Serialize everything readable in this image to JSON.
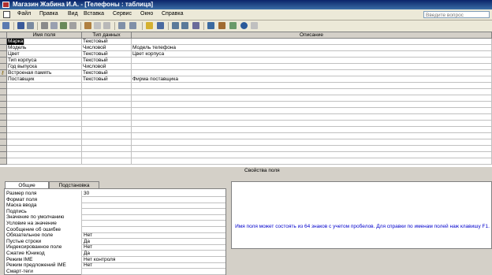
{
  "window": {
    "title": "Магазин Жабина И.А. - [Телефоны : таблица]"
  },
  "menu": {
    "items": [
      "Файл",
      "Правка",
      "Вид",
      "Вставка",
      "Сервис",
      "Окно",
      "Справка"
    ],
    "help_placeholder": "Введите вопрос"
  },
  "table": {
    "headers": {
      "name": "Имя поля",
      "type": "Тип данных",
      "desc": "Описание"
    },
    "rows": [
      {
        "name": "Марка",
        "type": "Текстовый",
        "desc": "",
        "key": false,
        "current": true
      },
      {
        "name": "Модель",
        "type": "Числовой",
        "desc": "Модель телефона",
        "key": false
      },
      {
        "name": "Цвет",
        "type": "Текстовый",
        "desc": "Цвет корпуса",
        "key": false
      },
      {
        "name": "Тип корпуса",
        "type": "Текстовый",
        "desc": "",
        "key": false
      },
      {
        "name": "Год выпуска",
        "type": "Числовой",
        "desc": "",
        "key": false
      },
      {
        "name": "Встроеная память",
        "type": "Текстовый",
        "desc": "",
        "key": true
      },
      {
        "name": "Поставщик",
        "type": "Текстовый",
        "desc": "Фирма поставщика",
        "key": false
      }
    ]
  },
  "properties": {
    "header": "Свойства поля",
    "tabs": [
      "Общие",
      "Подстановка"
    ],
    "rows": [
      {
        "label": "Размер поля",
        "value": "30"
      },
      {
        "label": "Формат поля",
        "value": ""
      },
      {
        "label": "Маска ввода",
        "value": ""
      },
      {
        "label": "Подпись",
        "value": ""
      },
      {
        "label": "Значение по умолчанию",
        "value": ""
      },
      {
        "label": "Условие на значение",
        "value": ""
      },
      {
        "label": "Сообщение об ошибке",
        "value": ""
      },
      {
        "label": "Обязательное поле",
        "value": "Нет"
      },
      {
        "label": "Пустые строки",
        "value": "Да"
      },
      {
        "label": "Индексированное поле",
        "value": "Нет"
      },
      {
        "label": "Сжатие Юникод",
        "value": "Да"
      },
      {
        "label": "Режим IME",
        "value": "Нет контроля"
      },
      {
        "label": "Режим предложений IME",
        "value": "Нет"
      },
      {
        "label": "Смарт-теги",
        "value": ""
      }
    ],
    "help_text": "Имя поля может состоять из 64 знаков с учетом пробелов.  Для справки по именам полей наж клавишу F1."
  },
  "colors": {
    "title_bar": "#0a246a",
    "help_text": "#0000cc"
  }
}
